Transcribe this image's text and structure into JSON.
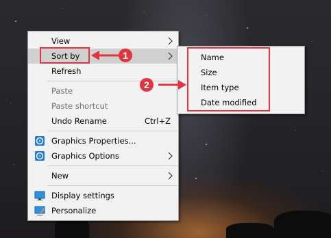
{
  "context_menu": {
    "items": [
      {
        "label": "View",
        "submenu": true
      },
      {
        "label": "Sort by",
        "submenu": true,
        "highlighted": true
      },
      {
        "label": "Refresh"
      },
      {
        "label": "Paste",
        "disabled": true
      },
      {
        "label": "Paste shortcut",
        "disabled": true
      },
      {
        "label": "Undo Rename",
        "shortcut": "Ctrl+Z"
      },
      {
        "label": "Graphics Properties...",
        "icon": "intel-graphics-icon"
      },
      {
        "label": "Graphics Options",
        "icon": "intel-graphics-icon",
        "submenu": true
      },
      {
        "label": "New",
        "submenu": true
      },
      {
        "label": "Display settings",
        "icon": "display-icon"
      },
      {
        "label": "Personalize",
        "icon": "personalize-icon"
      }
    ]
  },
  "sort_submenu": {
    "items": [
      {
        "label": "Name"
      },
      {
        "label": "Size"
      },
      {
        "label": "Item type"
      },
      {
        "label": "Date modified"
      }
    ]
  },
  "annotations": {
    "badge1": "1",
    "badge2": "2",
    "color": "#e0353e"
  }
}
